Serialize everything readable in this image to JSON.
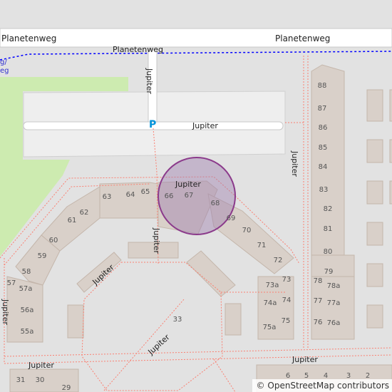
{
  "map": {
    "streets": {
      "main_top": "Planetenweg",
      "main_top_right": "Planetenweg",
      "secondary": "Planetenweg",
      "vertical_top": "Jupiter",
      "parking_lane": "Jupiter",
      "right_vertical": "Jupiter",
      "circle_top": "Jupiter",
      "center_vertical": "Jupiter",
      "left_diag": "Jupiter",
      "left_vertical": "Jupiter",
      "center_diag": "Jupiter",
      "bottom_left": "Jupiter",
      "bottom_right": "Jupiter"
    },
    "cycle_fragments": [
      "g/",
      "eg"
    ],
    "parking_symbol": "P",
    "house_numbers": {
      "h88": "88",
      "h87": "87",
      "h86": "86",
      "h85": "85",
      "h84": "84",
      "h83": "83",
      "h82": "82",
      "h81": "81",
      "h80": "80",
      "h79": "79",
      "h78": "78",
      "h78a": "78a",
      "h77": "77",
      "h77a": "77a",
      "h76": "76",
      "h76a": "76a",
      "h73": "73",
      "h73a": "73a",
      "h74": "74",
      "h74a": "74a",
      "h75": "75",
      "h75a": "75a",
      "h72": "72",
      "h71": "71",
      "h70": "70",
      "h69": "69",
      "h68": "68",
      "h67": "67",
      "h66": "66",
      "h65": "65",
      "h64": "64",
      "h63": "63",
      "h62": "62",
      "h61": "61",
      "h60": "60",
      "h59": "59",
      "h58": "58",
      "h57": "57",
      "h57a": "57a",
      "h56a": "56a",
      "h55a": "55a",
      "h33": "33",
      "h31": "31",
      "h30": "30",
      "h29": "29",
      "h6": "6",
      "h5": "5",
      "h4": "4",
      "h3": "3",
      "h2": "2"
    },
    "colors": {
      "background": "#e2e2e2",
      "building": "#d9d0c9",
      "building_stroke": "#c4b6ab",
      "road": "#ffffff",
      "footway": "#fa8072",
      "cycleway": "#0000ff",
      "grass": "#cdebb0",
      "parking": "#eeeeee",
      "marker_fill": "#a080b0",
      "marker_stroke": "#8b3a8b",
      "parking_blue": "#0092da"
    }
  },
  "attribution": {
    "symbol": "©",
    "text": "OpenStreetMap contributors"
  }
}
